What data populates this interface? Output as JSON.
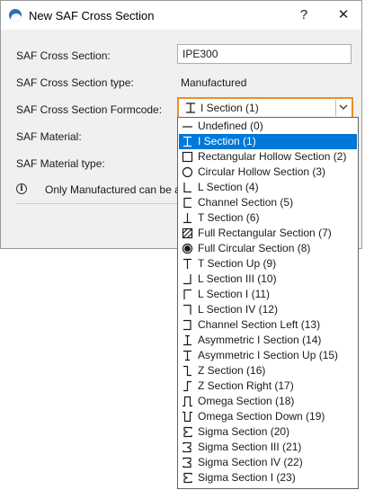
{
  "window": {
    "title": "New SAF Cross Section",
    "help_label": "?",
    "close_label": "✕"
  },
  "form": {
    "cross_section_label": "SAF Cross Section:",
    "cross_section_value": "IPE300",
    "type_label": "SAF Cross Section type:",
    "type_value": "Manufactured",
    "formcode_label": "SAF Cross Section Formcode:",
    "formcode_value": "I Section (1)",
    "formcode_icon": "i-section-icon",
    "material_label": "SAF Material:",
    "material_type_label": "SAF Material type:",
    "info_text": "Only Manufactured can be added"
  },
  "dropdown": {
    "selected_index": 1,
    "selection_color": "#0078d7",
    "options": [
      {
        "label": "Undefined (0)",
        "icon": "undefined-line-icon"
      },
      {
        "label": "I Section (1)",
        "icon": "i-section-icon"
      },
      {
        "label": "Rectangular Hollow Section (2)",
        "icon": "rectangular-hollow-icon"
      },
      {
        "label": "Circular Hollow Section (3)",
        "icon": "circular-hollow-icon"
      },
      {
        "label": "L Section (4)",
        "icon": "l-section-icon"
      },
      {
        "label": "Channel Section (5)",
        "icon": "channel-section-icon"
      },
      {
        "label": "T Section (6)",
        "icon": "t-section-icon"
      },
      {
        "label": "Full Rectangular Section (7)",
        "icon": "full-rectangular-icon"
      },
      {
        "label": "Full Circular Section (8)",
        "icon": "full-circular-icon"
      },
      {
        "label": "T Section Up (9)",
        "icon": "t-section-up-icon"
      },
      {
        "label": "L Section III (10)",
        "icon": "l-section-iii-icon"
      },
      {
        "label": "L Section I (11)",
        "icon": "l-section-i-icon"
      },
      {
        "label": "L Section IV (12)",
        "icon": "l-section-iv-icon"
      },
      {
        "label": "Channel Section Left (13)",
        "icon": "channel-section-left-icon"
      },
      {
        "label": "Asymmetric I Section (14)",
        "icon": "asymmetric-i-icon"
      },
      {
        "label": "Asymmetric I Section Up (15)",
        "icon": "asymmetric-i-up-icon"
      },
      {
        "label": "Z Section (16)",
        "icon": "z-section-icon"
      },
      {
        "label": "Z Section Right (17)",
        "icon": "z-section-right-icon"
      },
      {
        "label": "Omega Section (18)",
        "icon": "omega-section-icon"
      },
      {
        "label": "Omega Section Down (19)",
        "icon": "omega-section-down-icon"
      },
      {
        "label": "Sigma Section (20)",
        "icon": "sigma-section-icon"
      },
      {
        "label": "Sigma Section III (21)",
        "icon": "sigma-section-iii-icon"
      },
      {
        "label": "Sigma Section IV (22)",
        "icon": "sigma-section-iv-icon"
      },
      {
        "label": "Sigma Section I (23)",
        "icon": "sigma-section-i-icon"
      }
    ]
  }
}
